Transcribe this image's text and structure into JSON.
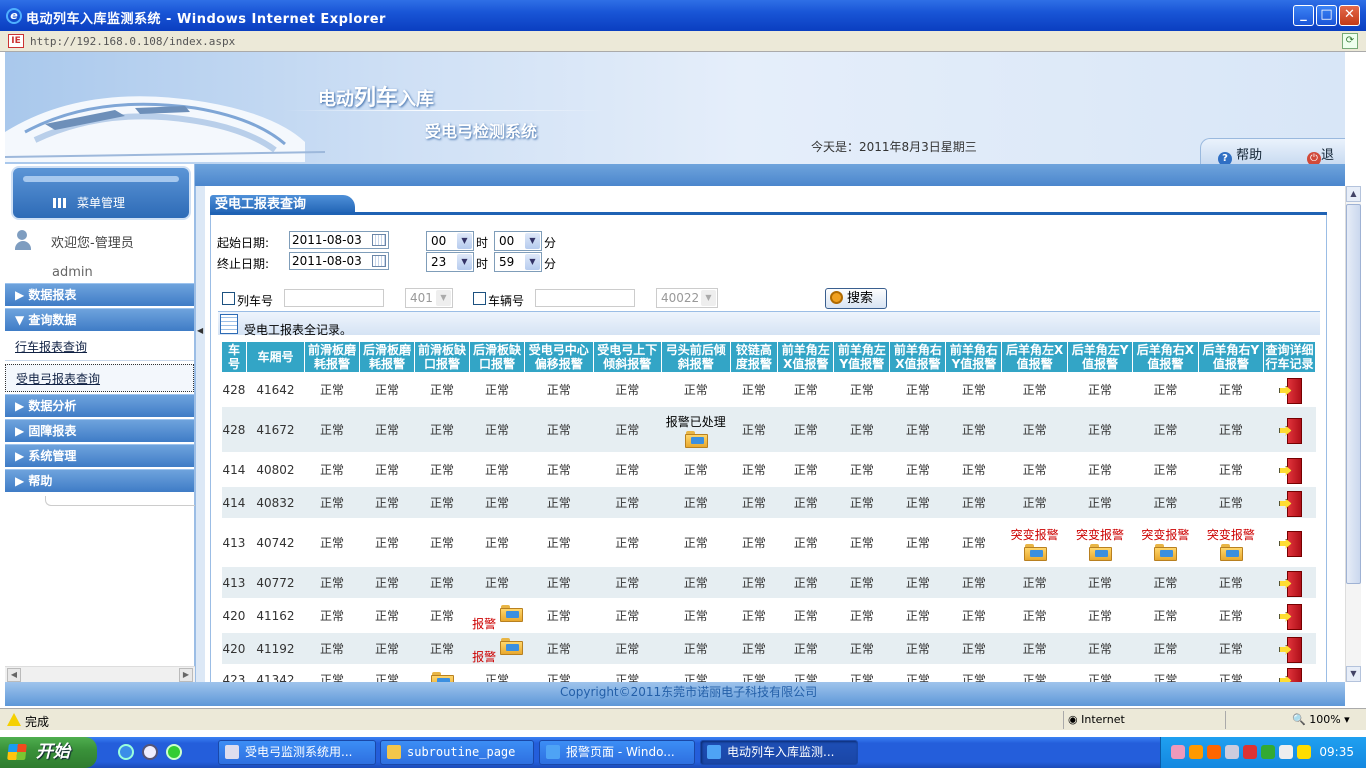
{
  "window": {
    "title": "电动列车入库监测系统 - Windows Internet Explorer",
    "address": "http://192.168.0.108/index.aspx"
  },
  "header": {
    "title_part1": "电动",
    "title_part2": "列车",
    "title_part3": "入库",
    "subtitle": "受电弓检测系统",
    "date_text": "今天是：2011年8月3日星期三",
    "help": "帮助",
    "exit": "退出"
  },
  "sidebar": {
    "menu_header": "菜单管理",
    "welcome": "欢迎您-管理员",
    "username": "admin",
    "items": [
      {
        "label": "▶ 数据报表"
      },
      {
        "label": "▼ 查询数据"
      },
      {
        "label": "行车报表查询"
      },
      {
        "label": "受电弓报表查询"
      },
      {
        "label": "▶ 数据分析"
      },
      {
        "label": "▶ 固障报表"
      },
      {
        "label": "▶ 系统管理"
      },
      {
        "label": "▶ 帮助"
      }
    ]
  },
  "main": {
    "section_title": "受电工报表查询",
    "start_date_label": "起始日期:",
    "start_date": "2011-08-03",
    "start_hour": "00",
    "start_min": "00",
    "end_date_label": "终止日期:",
    "end_date": "2011-08-03",
    "end_hour": "23",
    "end_min": "59",
    "hour_unit": "时",
    "min_unit": "分",
    "train_no_label": "列车号",
    "train_no_select": "401",
    "car_no_label": "车辆号",
    "car_no_select": "40022",
    "search_button": "搜索",
    "grid_caption": "受电工报表全记录。"
  },
  "table": {
    "headers": [
      "车号",
      "车厢号",
      "前滑板磨耗报警",
      "后滑板磨耗报警",
      "前滑板缺口报警",
      "后滑板缺口报警",
      "受电弓中心偏移报警",
      "受电弓上下倾斜报警",
      "弓头前后倾斜报警",
      "铰链高度报警",
      "前羊角左X值报警",
      "前羊角左Y值报警",
      "前羊角右X值报警",
      "前羊角右Y值报警",
      "后羊角左X值报警",
      "后羊角左Y值报警",
      "后羊角右X值报警",
      "后羊角右Y值报警",
      "查询详细行车记录"
    ],
    "normal": "正常",
    "alarm_handled": "报警已处理",
    "sudden_alarm": "突变报警",
    "alarm": "报警",
    "rows": [
      {
        "train": "428",
        "car": "41642",
        "cells": [
          "正常",
          "正常",
          "正常",
          "正常",
          "正常",
          "正常",
          "正常",
          "正常",
          "正常",
          "正常",
          "正常",
          "正常",
          "正常",
          "正常",
          "正常",
          "正常"
        ]
      },
      {
        "train": "428",
        "car": "41672",
        "cells": [
          "正常",
          "正常",
          "正常",
          "正常",
          "正常",
          "正常",
          "报警已处理",
          "正常",
          "正常",
          "正常",
          "正常",
          "正常",
          "正常",
          "正常",
          "正常",
          "正常"
        ]
      },
      {
        "train": "414",
        "car": "40802",
        "cells": [
          "正常",
          "正常",
          "正常",
          "正常",
          "正常",
          "正常",
          "正常",
          "正常",
          "正常",
          "正常",
          "正常",
          "正常",
          "正常",
          "正常",
          "正常",
          "正常"
        ]
      },
      {
        "train": "414",
        "car": "40832",
        "cells": [
          "正常",
          "正常",
          "正常",
          "正常",
          "正常",
          "正常",
          "正常",
          "正常",
          "正常",
          "正常",
          "正常",
          "正常",
          "正常",
          "正常",
          "正常",
          "正常"
        ]
      },
      {
        "train": "413",
        "car": "40742",
        "cells": [
          "正常",
          "正常",
          "正常",
          "正常",
          "正常",
          "正常",
          "正常",
          "正常",
          "正常",
          "正常",
          "正常",
          "正常",
          "突变报警",
          "突变报警",
          "突变报警",
          "突变报警"
        ]
      },
      {
        "train": "413",
        "car": "40772",
        "cells": [
          "正常",
          "正常",
          "正常",
          "正常",
          "正常",
          "正常",
          "正常",
          "正常",
          "正常",
          "正常",
          "正常",
          "正常",
          "正常",
          "正常",
          "正常",
          "正常"
        ]
      },
      {
        "train": "420",
        "car": "41162",
        "cells": [
          "正常",
          "正常",
          "正常",
          "报警",
          "正常",
          "正常",
          "正常",
          "正常",
          "正常",
          "正常",
          "正常",
          "正常",
          "正常",
          "正常",
          "正常",
          "正常"
        ]
      },
      {
        "train": "420",
        "car": "41192",
        "cells": [
          "正常",
          "正常",
          "正常",
          "报警",
          "正常",
          "正常",
          "正常",
          "正常",
          "正常",
          "正常",
          "正常",
          "正常",
          "正常",
          "正常",
          "正常",
          "正常"
        ]
      },
      {
        "train": "423",
        "car": "41342",
        "cells": [
          "正常",
          "正常",
          "icon",
          "正常",
          "正常",
          "正常",
          "正常",
          "正常",
          "正常",
          "正常",
          "正常",
          "正常",
          "正常",
          "正常",
          "正常",
          "正常"
        ]
      }
    ]
  },
  "footer": {
    "copyright": "Copyright©2011东莞市诺丽电子科技有限公司"
  },
  "statusbar": {
    "status": "完成",
    "zone": "Internet",
    "zoom": "100%"
  },
  "taskbar": {
    "start": "开始",
    "tasks": [
      {
        "label": "受电弓监测系统用..."
      },
      {
        "label": "subroutine_page"
      },
      {
        "label": "报警页面 - Windo..."
      },
      {
        "label": "电动列车入库监测..."
      }
    ],
    "clock": "09:35"
  }
}
